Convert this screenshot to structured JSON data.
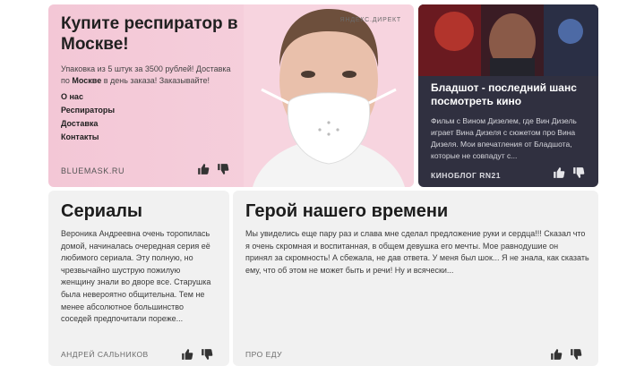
{
  "ad": {
    "title": "Купите респиратор в Москве!",
    "desc_before": "Упаковка из 5 штук за 3500 рублей! Доставка по ",
    "desc_bold": "Москве",
    "desc_after": " в день заказа! Заказывайте!",
    "links": [
      "О нас",
      "Респираторы",
      "Доставка",
      "Контакты"
    ],
    "domain": "BLUEMASK.RU",
    "sponsor": "ЯНДЕКС.ДИРЕКТ"
  },
  "movie": {
    "headline": "Бладшот - последний шанс посмотреть кино",
    "text": "Фильм с Вином Дизелем, где Вин Дизель играет Вина Дизеля с сюжетом про Вина Дизеля. Мои впечатления от Бладшота, которые не совпадут с...",
    "source": "КИНОБЛОГ RN21"
  },
  "series": {
    "title": "Сериалы",
    "text_lines": [
      "Вероника Андреевна очень торопилась",
      "домой, начиналась очередная серия её",
      "любимого сериала. Эту полную, но",
      "чрезвычайно шуструю пожилую",
      "женщину знали во дворе все. Старушка",
      "была невероятно общительна. Тем не",
      "менее абсолютное большинство",
      "соседей предпочитали пореже..."
    ],
    "author": "АНДРЕЙ САЛЬНИКОВ"
  },
  "hero": {
    "title": "Герой нашего времени",
    "text_lines": [
      "Мы увиделись еще пару раз и слава мне сделал предложение руки и сердца!!! Сказал что",
      "я очень скромная и воспитанная, в общем девушка его мечты. Мое равнодушие он",
      "принял за скромность! А сбежала, не дав ответа. У меня был шок... Я не знала, как сказать",
      "ему, что об этом не может быть и речи! Ну и всячески..."
    ],
    "author": "ПРО ЕДУ"
  },
  "icons": {
    "like": "thumbs-up-icon",
    "dislike": "thumbs-down-icon"
  },
  "colors": {
    "ad_bg": "#f5cedb",
    "movie_bg": "#303040",
    "card_bg": "#f1f1f1"
  }
}
